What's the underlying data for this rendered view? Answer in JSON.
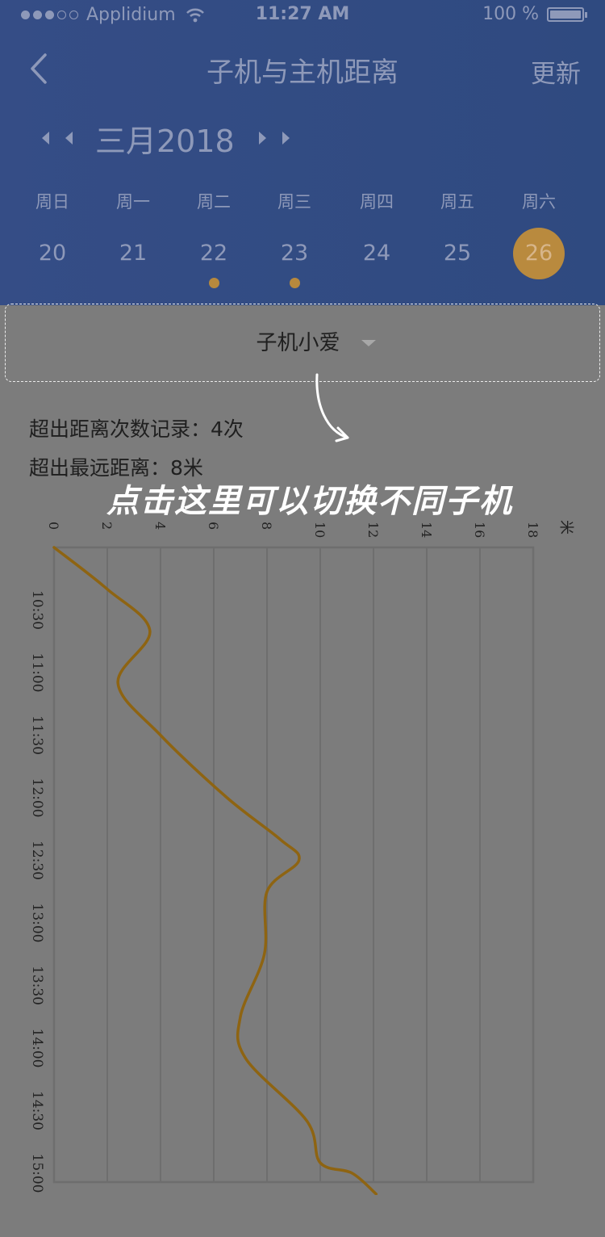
{
  "status_bar": {
    "carrier": "Applidium",
    "time": "11:27 AM",
    "battery": "100 %"
  },
  "nav": {
    "title": "子机与主机距离",
    "update_label": "更新"
  },
  "calendar": {
    "month_label": "三月2018",
    "weekdays": [
      "周日",
      "周一",
      "周二",
      "周三",
      "周四",
      "周五",
      "周六"
    ],
    "days": [
      "20",
      "21",
      "22",
      "23",
      "24",
      "25",
      "26"
    ],
    "selected_day": "26",
    "days_with_events": [
      "22",
      "23"
    ]
  },
  "device_selector": {
    "label": "子机小爱"
  },
  "stats": {
    "exceed_count": "超出距离次数记录：4次",
    "max_distance": "超出最远距离：8米"
  },
  "hint": {
    "text": "点击这里可以切换不同子机"
  },
  "colors": {
    "header_bg": "#324c84",
    "line": "#8e6412",
    "selected_day": "#b98a3e",
    "event_dot": "#b7893d"
  },
  "chart_data": {
    "type": "line",
    "orientation": "vertical-time",
    "x_unit": "米",
    "x_ticks": [
      "0",
      "2",
      "4",
      "6",
      "8",
      "10",
      "12",
      "14",
      "16",
      "18"
    ],
    "xlim": [
      0,
      18
    ],
    "y_ticks": [
      "10:30",
      "11:00",
      "11:30",
      "12:00",
      "12:30",
      "13:00",
      "13:30",
      "14:00",
      "14:30",
      "15:00"
    ],
    "series": [
      {
        "points": [
          {
            "time": "10:00",
            "distance": 0
          },
          {
            "time": "10:20",
            "distance": 2
          },
          {
            "time": "10:40",
            "distance": 3.6
          },
          {
            "time": "11:05",
            "distance": 2.4
          },
          {
            "time": "11:30",
            "distance": 4
          },
          {
            "time": "12:00",
            "distance": 6.5
          },
          {
            "time": "12:20",
            "distance": 8.5
          },
          {
            "time": "12:30",
            "distance": 9.2
          },
          {
            "time": "12:45",
            "distance": 8
          },
          {
            "time": "13:15",
            "distance": 7.9
          },
          {
            "time": "13:45",
            "distance": 7
          },
          {
            "time": "14:05",
            "distance": 7.2
          },
          {
            "time": "14:35",
            "distance": 9.5
          },
          {
            "time": "14:55",
            "distance": 10
          },
          {
            "time": "15:00",
            "distance": 11.2
          },
          {
            "time": "15:10",
            "distance": 12.1
          }
        ]
      }
    ]
  }
}
